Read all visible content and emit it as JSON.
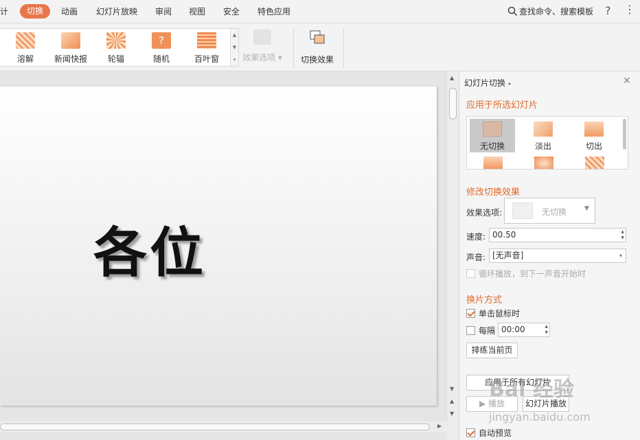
{
  "menu": {
    "partial_left": "计",
    "active": "切换",
    "items": [
      "动画",
      "幻灯片放映",
      "审阅",
      "视图",
      "安全",
      "特色应用"
    ],
    "search": "查找命令、搜索模板",
    "help": "?",
    "more": "⋮"
  },
  "ribbon": {
    "effects": [
      "溶解",
      "新闻快报",
      "轮辐",
      "随机",
      "百叶窗"
    ],
    "effect_options": "效果选项",
    "switch_effect": "切换效果"
  },
  "slide": {
    "text": "各位"
  },
  "panel": {
    "title": "幻灯片切换",
    "apply_selected": "应用于所选幻灯片",
    "transitions": [
      "无切换",
      "淡出",
      "切出"
    ],
    "modify_title": "修改切换效果",
    "effect_option_label": "效果选项:",
    "effect_option_value": "无切换",
    "speed_label": "速度:",
    "speed_value": "00.50",
    "sound_label": "声音:",
    "sound_value": "[无声音]",
    "loop_label": "循环播放，到下一声音开始时",
    "advance_title": "换片方式",
    "on_click_label": "单击鼠标时",
    "every_label": "每隔",
    "every_value": "00:00",
    "rehearse": "排练当前页",
    "apply_all": "应用于所有幻灯片",
    "play": "播放",
    "slideshow": "幻灯片播放",
    "autopreview": "自动预览"
  },
  "watermark": {
    "main": "Bai 经验",
    "sub": "jingyan.baidu.com"
  },
  "colors": {
    "accent": "#e8764a",
    "section": "#e06a2c"
  }
}
